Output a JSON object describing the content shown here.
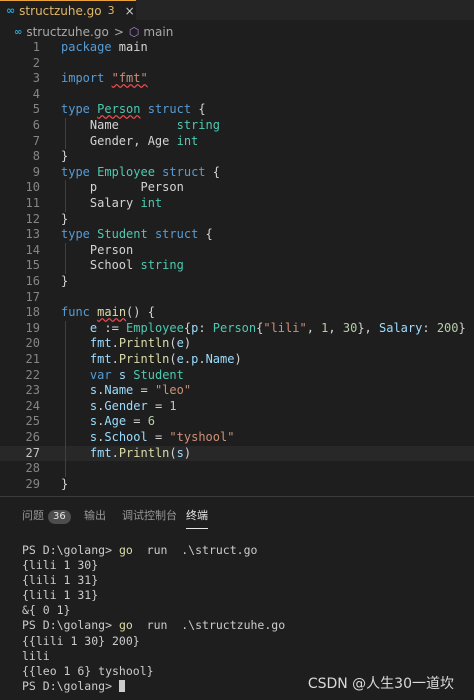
{
  "tab": {
    "filename": "structzuhe.go",
    "badge": "3",
    "close": "×"
  },
  "breadcrumb": {
    "file": "structzuhe.go",
    "separator": ">",
    "symbol": "main"
  },
  "editor": {
    "lines": [
      {
        "n": "1",
        "tokens": [
          [
            "kw",
            "package"
          ],
          [
            "pl",
            " main"
          ]
        ]
      },
      {
        "n": "2",
        "tokens": []
      },
      {
        "n": "3",
        "tokens": [
          [
            "kw",
            "import"
          ],
          [
            "pl",
            " "
          ],
          [
            "str ul",
            "\"fmt\""
          ]
        ]
      },
      {
        "n": "4",
        "tokens": []
      },
      {
        "n": "5",
        "tokens": [
          [
            "kw",
            "type"
          ],
          [
            "pl",
            " "
          ],
          [
            "ty ul",
            "Person"
          ],
          [
            "pl",
            " "
          ],
          [
            "kw",
            "struct"
          ],
          [
            "pl",
            " {"
          ]
        ]
      },
      {
        "n": "6",
        "tokens": [
          [
            "pl",
            "    "
          ],
          [
            "pl",
            "Name        "
          ],
          [
            "ty",
            "string"
          ]
        ]
      },
      {
        "n": "7",
        "tokens": [
          [
            "pl",
            "    "
          ],
          [
            "pl",
            "Gender, Age "
          ],
          [
            "ty",
            "int"
          ]
        ]
      },
      {
        "n": "8",
        "tokens": [
          [
            "pl",
            "}"
          ]
        ]
      },
      {
        "n": "9",
        "tokens": [
          [
            "kw",
            "type"
          ],
          [
            "pl",
            " "
          ],
          [
            "ty",
            "Employee"
          ],
          [
            "pl",
            " "
          ],
          [
            "kw",
            "struct"
          ],
          [
            "pl",
            " {"
          ]
        ]
      },
      {
        "n": "10",
        "tokens": [
          [
            "pl",
            "    "
          ],
          [
            "pl",
            "p      "
          ],
          [
            "pl",
            "Person"
          ]
        ]
      },
      {
        "n": "11",
        "tokens": [
          [
            "pl",
            "    "
          ],
          [
            "pl",
            "Salary "
          ],
          [
            "ty",
            "int"
          ]
        ]
      },
      {
        "n": "12",
        "tokens": [
          [
            "pl",
            "}"
          ]
        ]
      },
      {
        "n": "13",
        "tokens": [
          [
            "kw",
            "type"
          ],
          [
            "pl",
            " "
          ],
          [
            "ty",
            "Student"
          ],
          [
            "pl",
            " "
          ],
          [
            "kw",
            "struct"
          ],
          [
            "pl",
            " {"
          ]
        ]
      },
      {
        "n": "14",
        "tokens": [
          [
            "pl",
            "    "
          ],
          [
            "pl",
            "Person"
          ]
        ]
      },
      {
        "n": "15",
        "tokens": [
          [
            "pl",
            "    "
          ],
          [
            "pl",
            "School "
          ],
          [
            "ty",
            "string"
          ]
        ]
      },
      {
        "n": "16",
        "tokens": [
          [
            "pl",
            "}"
          ]
        ]
      },
      {
        "n": "17",
        "tokens": []
      },
      {
        "n": "18",
        "tokens": [
          [
            "kw",
            "func"
          ],
          [
            "pl",
            " "
          ],
          [
            "fn ul",
            "main"
          ],
          [
            "pl",
            "() {"
          ]
        ]
      },
      {
        "n": "19",
        "tokens": [
          [
            "pl",
            "    "
          ],
          [
            "id",
            "e"
          ],
          [
            "pl",
            " := "
          ],
          [
            "ty",
            "Employee"
          ],
          [
            "pl",
            "{"
          ],
          [
            "id",
            "p"
          ],
          [
            "pl",
            ": "
          ],
          [
            "ty",
            "Person"
          ],
          [
            "pl",
            "{"
          ],
          [
            "str",
            "\"lili\""
          ],
          [
            "pl",
            ", "
          ],
          [
            "num",
            "1"
          ],
          [
            "pl",
            ", "
          ],
          [
            "num",
            "30"
          ],
          [
            "pl",
            "}, "
          ],
          [
            "id",
            "Salary"
          ],
          [
            "pl",
            ": "
          ],
          [
            "num",
            "200"
          ],
          [
            "pl",
            "}"
          ]
        ]
      },
      {
        "n": "20",
        "tokens": [
          [
            "pl",
            "    "
          ],
          [
            "id",
            "fmt"
          ],
          [
            "pl",
            "."
          ],
          [
            "fn",
            "Println"
          ],
          [
            "pl",
            "("
          ],
          [
            "id",
            "e"
          ],
          [
            "pl",
            ")"
          ]
        ]
      },
      {
        "n": "21",
        "tokens": [
          [
            "pl",
            "    "
          ],
          [
            "id",
            "fmt"
          ],
          [
            "pl",
            "."
          ],
          [
            "fn",
            "Println"
          ],
          [
            "pl",
            "("
          ],
          [
            "id",
            "e"
          ],
          [
            "pl",
            "."
          ],
          [
            "id",
            "p"
          ],
          [
            "pl",
            "."
          ],
          [
            "id",
            "Name"
          ],
          [
            "pl",
            ")"
          ]
        ]
      },
      {
        "n": "22",
        "tokens": [
          [
            "pl",
            "    "
          ],
          [
            "kw",
            "var"
          ],
          [
            "pl",
            " "
          ],
          [
            "id",
            "s"
          ],
          [
            "pl",
            " "
          ],
          [
            "ty",
            "Student"
          ]
        ]
      },
      {
        "n": "23",
        "tokens": [
          [
            "pl",
            "    "
          ],
          [
            "id",
            "s"
          ],
          [
            "pl",
            "."
          ],
          [
            "id",
            "Name"
          ],
          [
            "pl",
            " = "
          ],
          [
            "str",
            "\"leo\""
          ]
        ]
      },
      {
        "n": "24",
        "tokens": [
          [
            "pl",
            "    "
          ],
          [
            "id",
            "s"
          ],
          [
            "pl",
            "."
          ],
          [
            "id",
            "Gender"
          ],
          [
            "pl",
            " = "
          ],
          [
            "num",
            "1"
          ]
        ]
      },
      {
        "n": "25",
        "tokens": [
          [
            "pl",
            "    "
          ],
          [
            "id",
            "s"
          ],
          [
            "pl",
            "."
          ],
          [
            "id",
            "Age"
          ],
          [
            "pl",
            " = "
          ],
          [
            "num",
            "6"
          ]
        ]
      },
      {
        "n": "26",
        "tokens": [
          [
            "pl",
            "    "
          ],
          [
            "id",
            "s"
          ],
          [
            "pl",
            "."
          ],
          [
            "id",
            "School"
          ],
          [
            "pl",
            " = "
          ],
          [
            "str",
            "\"tyshool\""
          ]
        ]
      },
      {
        "n": "27",
        "tokens": [
          [
            "pl",
            "    "
          ],
          [
            "id",
            "fmt"
          ],
          [
            "pl",
            "."
          ],
          [
            "fn",
            "Println"
          ],
          [
            "pl",
            "("
          ],
          [
            "id",
            "s"
          ],
          [
            "pl",
            ")"
          ]
        ],
        "current": true
      },
      {
        "n": "28",
        "tokens": []
      },
      {
        "n": "29",
        "tokens": [
          [
            "pl",
            "}"
          ]
        ]
      }
    ]
  },
  "panel": {
    "tabs": {
      "problems": "问题",
      "problems_count": "36",
      "output": "输出",
      "debug": "调试控制台",
      "terminal": "终端"
    },
    "terminal_lines": [
      {
        "prompt": "PS D:\\golang> ",
        "cmd": "go",
        "rest": "  run  .\\struct.go"
      },
      {
        "text": "{lili 1 30}"
      },
      {
        "text": "{lili 1 31}"
      },
      {
        "text": "{lili 1 31}"
      },
      {
        "text": "&{ 0 1}"
      },
      {
        "prompt": "PS D:\\golang> ",
        "cmd": "go",
        "rest": "  run  .\\structzuhe.go"
      },
      {
        "text": "{{lili 1 30} 200}"
      },
      {
        "text": "lili"
      },
      {
        "text": "{{leo 1 6} tyshool}"
      },
      {
        "prompt": "PS D:\\golang> ",
        "cursor": true
      }
    ]
  },
  "watermark": "CSDN @人生30一道坎"
}
